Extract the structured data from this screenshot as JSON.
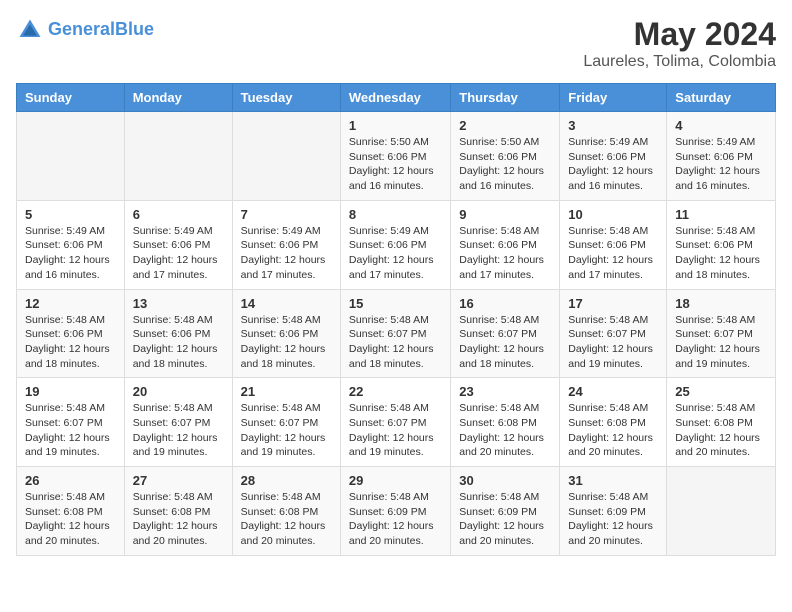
{
  "header": {
    "logo_line1": "General",
    "logo_line2": "Blue",
    "main_title": "May 2024",
    "subtitle": "Laureles, Tolima, Colombia"
  },
  "weekdays": [
    "Sunday",
    "Monday",
    "Tuesday",
    "Wednesday",
    "Thursday",
    "Friday",
    "Saturday"
  ],
  "weeks": [
    [
      {
        "day": "",
        "info": ""
      },
      {
        "day": "",
        "info": ""
      },
      {
        "day": "",
        "info": ""
      },
      {
        "day": "1",
        "info": "Sunrise: 5:50 AM\nSunset: 6:06 PM\nDaylight: 12 hours\nand 16 minutes."
      },
      {
        "day": "2",
        "info": "Sunrise: 5:50 AM\nSunset: 6:06 PM\nDaylight: 12 hours\nand 16 minutes."
      },
      {
        "day": "3",
        "info": "Sunrise: 5:49 AM\nSunset: 6:06 PM\nDaylight: 12 hours\nand 16 minutes."
      },
      {
        "day": "4",
        "info": "Sunrise: 5:49 AM\nSunset: 6:06 PM\nDaylight: 12 hours\nand 16 minutes."
      }
    ],
    [
      {
        "day": "5",
        "info": "Sunrise: 5:49 AM\nSunset: 6:06 PM\nDaylight: 12 hours\nand 16 minutes."
      },
      {
        "day": "6",
        "info": "Sunrise: 5:49 AM\nSunset: 6:06 PM\nDaylight: 12 hours\nand 17 minutes."
      },
      {
        "day": "7",
        "info": "Sunrise: 5:49 AM\nSunset: 6:06 PM\nDaylight: 12 hours\nand 17 minutes."
      },
      {
        "day": "8",
        "info": "Sunrise: 5:49 AM\nSunset: 6:06 PM\nDaylight: 12 hours\nand 17 minutes."
      },
      {
        "day": "9",
        "info": "Sunrise: 5:48 AM\nSunset: 6:06 PM\nDaylight: 12 hours\nand 17 minutes."
      },
      {
        "day": "10",
        "info": "Sunrise: 5:48 AM\nSunset: 6:06 PM\nDaylight: 12 hours\nand 17 minutes."
      },
      {
        "day": "11",
        "info": "Sunrise: 5:48 AM\nSunset: 6:06 PM\nDaylight: 12 hours\nand 18 minutes."
      }
    ],
    [
      {
        "day": "12",
        "info": "Sunrise: 5:48 AM\nSunset: 6:06 PM\nDaylight: 12 hours\nand 18 minutes."
      },
      {
        "day": "13",
        "info": "Sunrise: 5:48 AM\nSunset: 6:06 PM\nDaylight: 12 hours\nand 18 minutes."
      },
      {
        "day": "14",
        "info": "Sunrise: 5:48 AM\nSunset: 6:06 PM\nDaylight: 12 hours\nand 18 minutes."
      },
      {
        "day": "15",
        "info": "Sunrise: 5:48 AM\nSunset: 6:07 PM\nDaylight: 12 hours\nand 18 minutes."
      },
      {
        "day": "16",
        "info": "Sunrise: 5:48 AM\nSunset: 6:07 PM\nDaylight: 12 hours\nand 18 minutes."
      },
      {
        "day": "17",
        "info": "Sunrise: 5:48 AM\nSunset: 6:07 PM\nDaylight: 12 hours\nand 19 minutes."
      },
      {
        "day": "18",
        "info": "Sunrise: 5:48 AM\nSunset: 6:07 PM\nDaylight: 12 hours\nand 19 minutes."
      }
    ],
    [
      {
        "day": "19",
        "info": "Sunrise: 5:48 AM\nSunset: 6:07 PM\nDaylight: 12 hours\nand 19 minutes."
      },
      {
        "day": "20",
        "info": "Sunrise: 5:48 AM\nSunset: 6:07 PM\nDaylight: 12 hours\nand 19 minutes."
      },
      {
        "day": "21",
        "info": "Sunrise: 5:48 AM\nSunset: 6:07 PM\nDaylight: 12 hours\nand 19 minutes."
      },
      {
        "day": "22",
        "info": "Sunrise: 5:48 AM\nSunset: 6:07 PM\nDaylight: 12 hours\nand 19 minutes."
      },
      {
        "day": "23",
        "info": "Sunrise: 5:48 AM\nSunset: 6:08 PM\nDaylight: 12 hours\nand 20 minutes."
      },
      {
        "day": "24",
        "info": "Sunrise: 5:48 AM\nSunset: 6:08 PM\nDaylight: 12 hours\nand 20 minutes."
      },
      {
        "day": "25",
        "info": "Sunrise: 5:48 AM\nSunset: 6:08 PM\nDaylight: 12 hours\nand 20 minutes."
      }
    ],
    [
      {
        "day": "26",
        "info": "Sunrise: 5:48 AM\nSunset: 6:08 PM\nDaylight: 12 hours\nand 20 minutes."
      },
      {
        "day": "27",
        "info": "Sunrise: 5:48 AM\nSunset: 6:08 PM\nDaylight: 12 hours\nand 20 minutes."
      },
      {
        "day": "28",
        "info": "Sunrise: 5:48 AM\nSunset: 6:08 PM\nDaylight: 12 hours\nand 20 minutes."
      },
      {
        "day": "29",
        "info": "Sunrise: 5:48 AM\nSunset: 6:09 PM\nDaylight: 12 hours\nand 20 minutes."
      },
      {
        "day": "30",
        "info": "Sunrise: 5:48 AM\nSunset: 6:09 PM\nDaylight: 12 hours\nand 20 minutes."
      },
      {
        "day": "31",
        "info": "Sunrise: 5:48 AM\nSunset: 6:09 PM\nDaylight: 12 hours\nand 20 minutes."
      },
      {
        "day": "",
        "info": ""
      }
    ]
  ]
}
